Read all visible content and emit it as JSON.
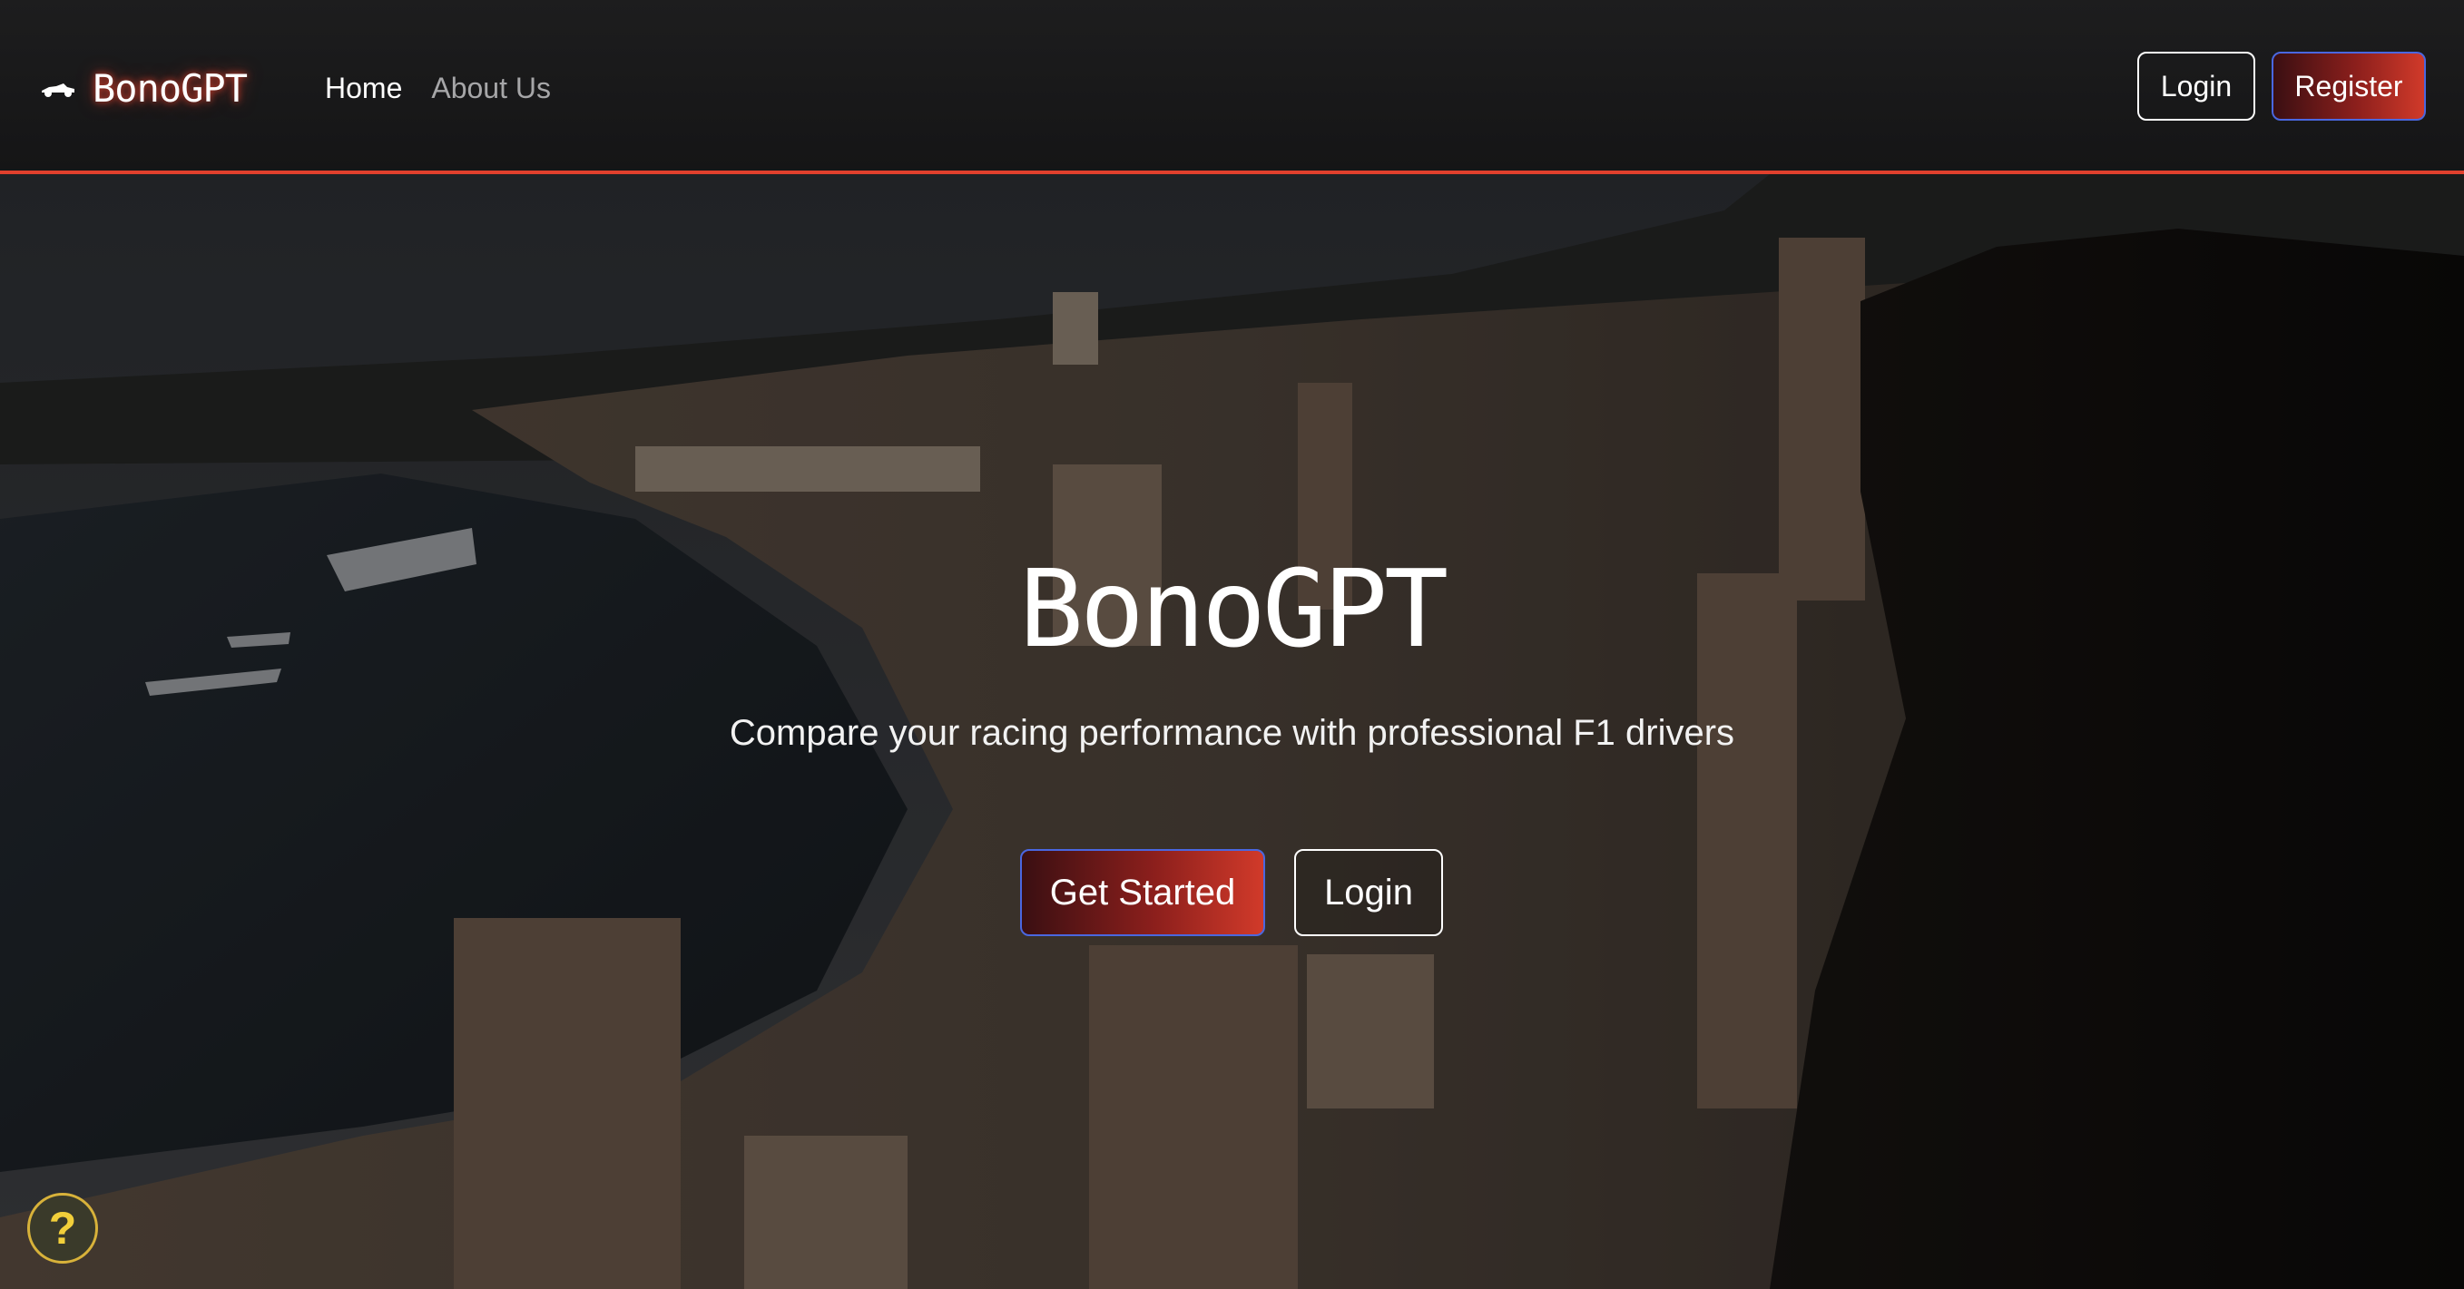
{
  "navbar": {
    "brand": "BonoGPT",
    "brand_icon": "race-car-icon",
    "links": [
      {
        "label": "Home",
        "active": true
      },
      {
        "label": "About Us",
        "active": false
      }
    ],
    "login_label": "Login",
    "register_label": "Register"
  },
  "hero": {
    "title": "BonoGPT",
    "subtitle": "Compare your racing performance with professional F1 drivers",
    "get_started_label": "Get Started",
    "login_label": "Login",
    "background": "aerial-city-harbor-photo"
  },
  "help": {
    "label": "?",
    "icon": "help-question-icon"
  },
  "colors": {
    "accent": "#e0402d",
    "button_border": "#4a67e0",
    "navbar_bg": "#1a1a1b",
    "help_yellow": "#f2cf3a"
  }
}
